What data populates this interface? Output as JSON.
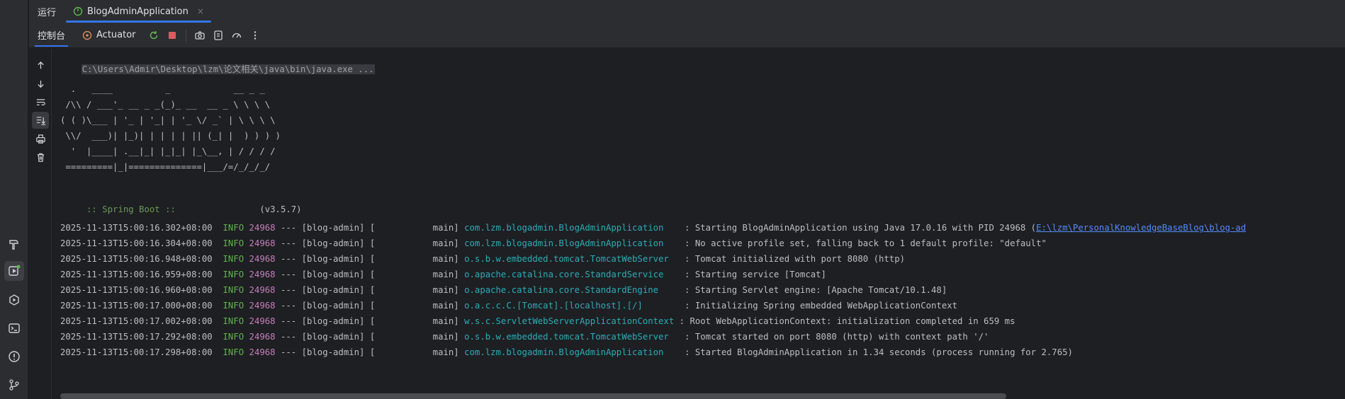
{
  "tabs": {
    "title": "运行",
    "active_tab": "BlogAdminApplication",
    "close_glyph": "×"
  },
  "toolbar": {
    "console_label": "控制台",
    "actuator_label": "Actuator"
  },
  "console": {
    "command": "C:\\Users\\Admir\\Desktop\\lzm\\论文相关\\java\\bin\\java.exe ...",
    "banner": [
      "  .   ____          _            __ _ _",
      " /\\\\ / ___'_ __ _ _(_)_ __  __ _ \\ \\ \\ \\",
      "( ( )\\___ | '_ | '_| | '_ \\/ _` | \\ \\ \\ \\",
      " \\\\/  ___)| |_)| | | | | || (_| |  ) ) ) )",
      "  '  |____| .__|_| |_|_| |_\\__, | / / / /",
      " =========|_|==============|___/=/_/_/_/"
    ],
    "spring_label": " :: Spring Boot :: ",
    "spring_version": "               (v3.5.7)",
    "logs": [
      {
        "ts": "2025-11-13T15:00:16.302+08:00",
        "level": "INFO",
        "pid": "24968",
        "mid": " --- [blog-admin] [           main] ",
        "logger": "com.lzm.blogadmin.BlogAdminApplication   ",
        "msg": " : Starting BlogAdminApplication using Java 17.0.16 with PID 24968 (",
        "link": "E:\\lzm\\PersonalKnowledgeBaseBlog\\blog-ad"
      },
      {
        "ts": "2025-11-13T15:00:16.304+08:00",
        "level": "INFO",
        "pid": "24968",
        "mid": " --- [blog-admin] [           main] ",
        "logger": "com.lzm.blogadmin.BlogAdminApplication   ",
        "msg": " : No active profile set, falling back to 1 default profile: \"default\"",
        "link": ""
      },
      {
        "ts": "2025-11-13T15:00:16.948+08:00",
        "level": "INFO",
        "pid": "24968",
        "mid": " --- [blog-admin] [           main] ",
        "logger": "o.s.b.w.embedded.tomcat.TomcatWebServer  ",
        "msg": " : Tomcat initialized with port 8080 (http)",
        "link": ""
      },
      {
        "ts": "2025-11-13T15:00:16.959+08:00",
        "level": "INFO",
        "pid": "24968",
        "mid": " --- [blog-admin] [           main] ",
        "logger": "o.apache.catalina.core.StandardService   ",
        "msg": " : Starting service [Tomcat]",
        "link": ""
      },
      {
        "ts": "2025-11-13T15:00:16.960+08:00",
        "level": "INFO",
        "pid": "24968",
        "mid": " --- [blog-admin] [           main] ",
        "logger": "o.apache.catalina.core.StandardEngine    ",
        "msg": " : Starting Servlet engine: [Apache Tomcat/10.1.48]",
        "link": ""
      },
      {
        "ts": "2025-11-13T15:00:17.000+08:00",
        "level": "INFO",
        "pid": "24968",
        "mid": " --- [blog-admin] [           main] ",
        "logger": "o.a.c.c.C.[Tomcat].[localhost].[/]       ",
        "msg": " : Initializing Spring embedded WebApplicationContext",
        "link": ""
      },
      {
        "ts": "2025-11-13T15:00:17.002+08:00",
        "level": "INFO",
        "pid": "24968",
        "mid": " --- [blog-admin] [           main] ",
        "logger": "w.s.c.ServletWebServerApplicationContext",
        "msg": " : Root WebApplicationContext: initialization completed in 659 ms",
        "link": ""
      },
      {
        "ts": "2025-11-13T15:00:17.292+08:00",
        "level": "INFO",
        "pid": "24968",
        "mid": " --- [blog-admin] [           main] ",
        "logger": "o.s.b.w.embedded.tomcat.TomcatWebServer  ",
        "msg": " : Tomcat started on port 8080 (http) with context path '/'",
        "link": ""
      },
      {
        "ts": "2025-11-13T15:00:17.298+08:00",
        "level": "INFO",
        "pid": "24968",
        "mid": " --- [blog-admin] [           main] ",
        "logger": "com.lzm.blogadmin.BlogAdminApplication   ",
        "msg": " : Started BlogAdminApplication in 1.34 seconds (process running for 2.765)",
        "link": ""
      }
    ]
  },
  "colors": {
    "background": "#1e1f22",
    "panel": "#2b2d30",
    "accent": "#3574f0",
    "info": "#5fb44e",
    "pid": "#c77dbb",
    "logger": "#2aacb8",
    "spring": "#6a9955"
  }
}
